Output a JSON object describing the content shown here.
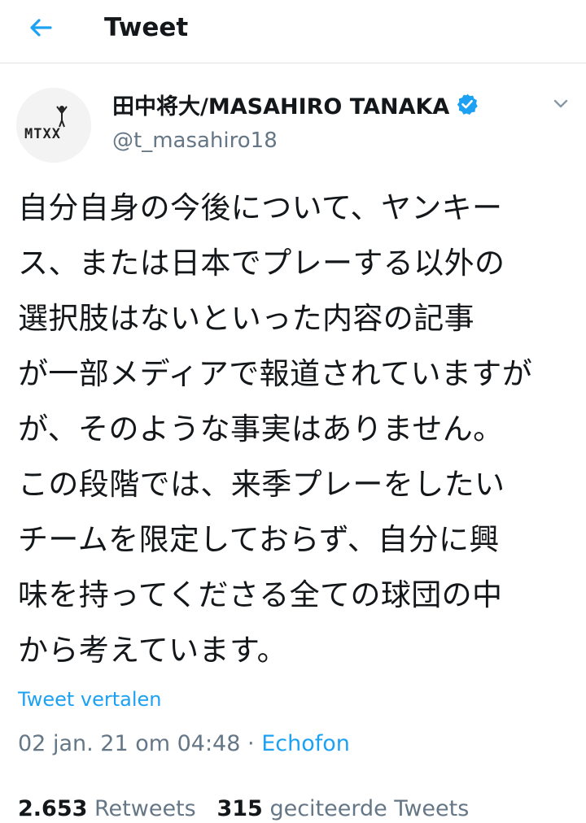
{
  "header": {
    "title": "Tweet",
    "back_icon": "arrow-left-icon",
    "accent_color": "#1da1f2"
  },
  "author": {
    "display_name": "田中将大/MASAHIRO TANAKA",
    "handle": "@t_masahiro18",
    "verified": true,
    "avatar_logo_text": "MTXX"
  },
  "tweet": {
    "lines": [
      "自分自身の今後について、ヤンキー",
      "ス、または日本でプレーする以外の",
      "選択肢はないといった内容の記事",
      "が一部メディアで報道されていますが",
      "が、そのような事実はありません。",
      "この段階では、来季プレーをしたい",
      "チームを限定しておらず、自分に興",
      "味を持ってくださる全ての球団の中",
      "から考えています。"
    ],
    "translate_label": "Tweet vertalen",
    "timestamp": "02 jan. 21 om 04:48",
    "separator": "·",
    "source": "Echofon"
  },
  "stats": {
    "retweets_count": "2.653",
    "retweets_label": "Retweets",
    "likes_count": "315",
    "likes_label": "geciteerde Tweets"
  }
}
